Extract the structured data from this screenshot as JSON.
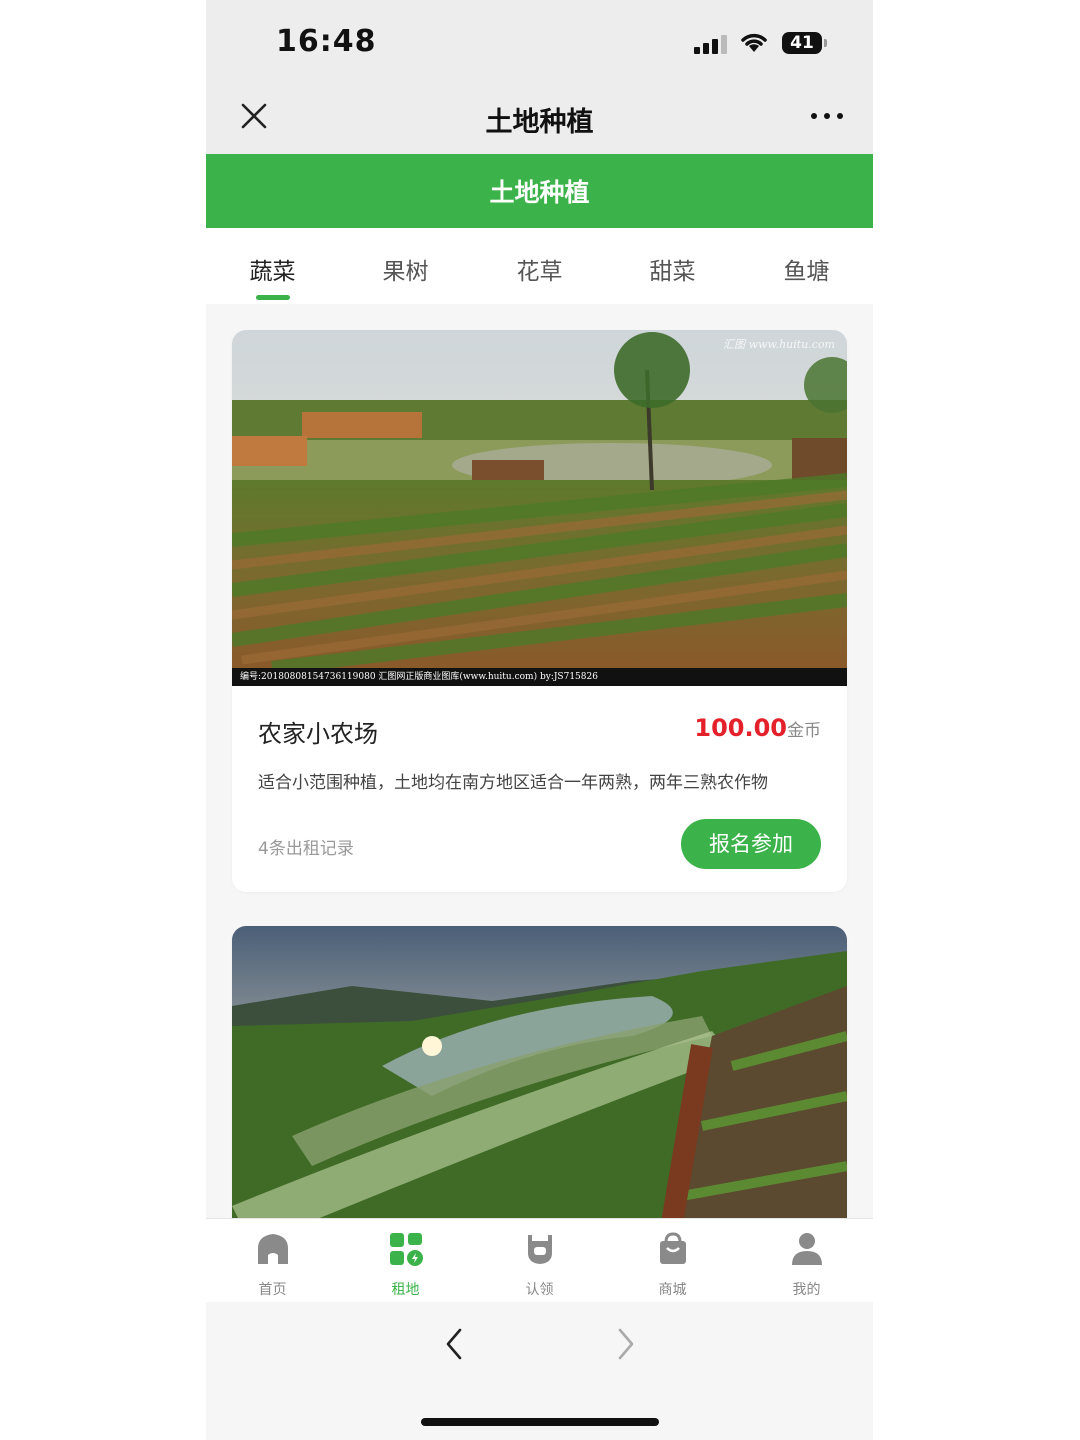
{
  "status_bar": {
    "time": "16:48",
    "battery": "41"
  },
  "nav": {
    "title": "土地种植"
  },
  "banner": {
    "title": "土地种植"
  },
  "tabs": [
    {
      "label": "蔬菜"
    },
    {
      "label": "果树"
    },
    {
      "label": "花草"
    },
    {
      "label": "甜菜"
    },
    {
      "label": "鱼塘"
    }
  ],
  "cards": [
    {
      "caption": "编号:20180808154736119080   汇图网正版商业图库(www.huitu.com) by:JS715826",
      "watermark": "汇图 www.huitu.com",
      "name": "农家小农场",
      "price": "100.00",
      "unit": "金币",
      "desc": "适合小范围种植，土地均在南方地区适合一年两熟，两年三熟农作物",
      "records": "4条出租记录",
      "button": "报名参加"
    }
  ],
  "tabbar": [
    {
      "label": "首页",
      "icon": "home-icon"
    },
    {
      "label": "租地",
      "icon": "land-icon"
    },
    {
      "label": "认领",
      "icon": "claim-icon"
    },
    {
      "label": "商城",
      "icon": "shop-bag-icon"
    },
    {
      "label": "我的",
      "icon": "person-icon"
    }
  ],
  "colors": {
    "accent": "#3cb34a",
    "price": "#e4202a"
  }
}
